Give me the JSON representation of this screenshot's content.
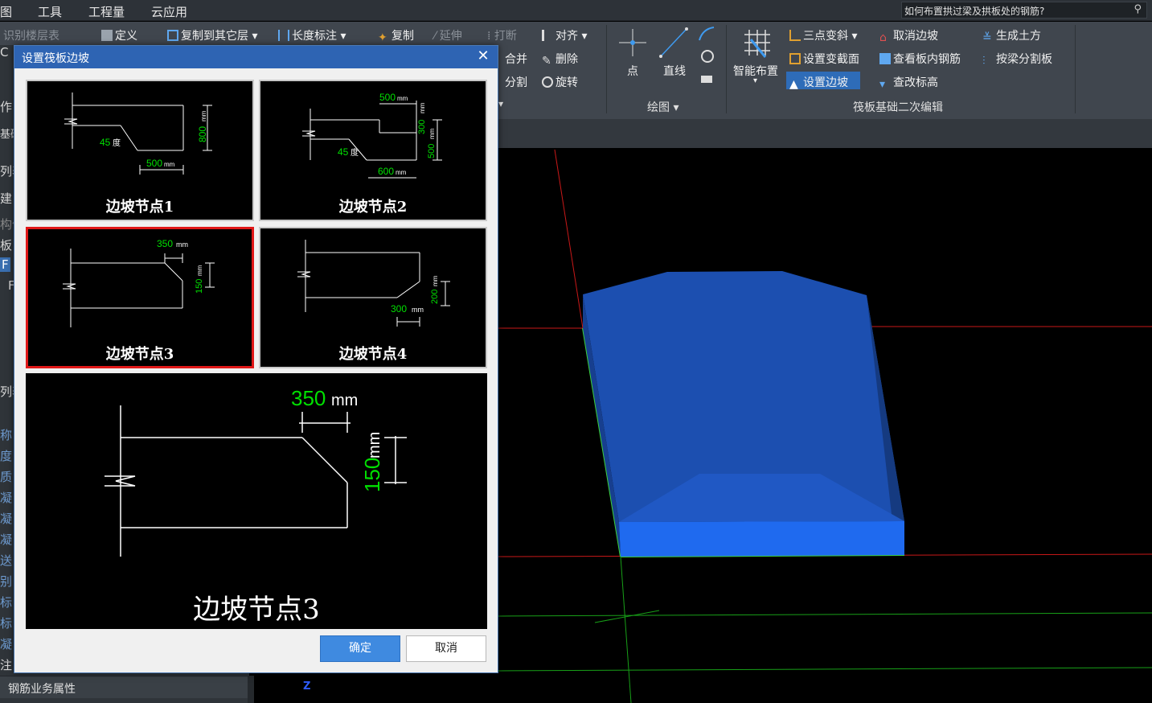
{
  "menubar": {
    "items": [
      "图",
      "工具",
      "工程量",
      "云应用"
    ],
    "help_search_value": "如何布置拱过梁及拱板处的钢筋?"
  },
  "ribbon": {
    "row1_left": [
      "识别楼层表",
      "定义",
      "复制到其它层",
      "长度标注",
      "复制",
      "延伸",
      "打断",
      "对齐"
    ],
    "row2_left": [
      "合并",
      "删除"
    ],
    "row3_left": [
      "分割",
      "旋转"
    ],
    "draw": {
      "point": "点",
      "line": "直线",
      "group_label": "绘图"
    },
    "smart_layout": "智能布置",
    "raft_edit": {
      "col1": [
        "三点变斜",
        "设置变截面",
        "设置边坡"
      ],
      "col2": [
        "取消边坡",
        "查看板内钢筋",
        "查改标高"
      ],
      "col3": [
        "生成土方",
        "按梁分割板"
      ],
      "group_label": "筏板基础二次编辑"
    }
  },
  "left_panel": {
    "fragments_top": [
      "作",
      "基础",
      "列表",
      "建",
      "构件",
      "板",
      "F",
      "F"
    ],
    "fragments_props": [
      "列表",
      "称",
      "度",
      "质",
      "凝",
      "凝",
      "凝",
      "送",
      "别",
      "标",
      "标",
      "凝",
      "注"
    ],
    "property_tab": "钢筋业务属性"
  },
  "dialog": {
    "title": "设置筏板边坡",
    "options": [
      {
        "caption": "边坡节点1",
        "dims": [
          "45",
          "度",
          "500",
          "mm",
          "800",
          "mm"
        ]
      },
      {
        "caption": "边坡节点2",
        "dims": [
          "500",
          "mm",
          "300",
          "mm",
          "45",
          "度",
          "500",
          "mm",
          "600",
          "mm"
        ]
      },
      {
        "caption": "边坡节点3",
        "dims": [
          "350",
          "mm",
          "150",
          "mm"
        ]
      },
      {
        "caption": "边坡节点4",
        "dims": [
          "200",
          "mm",
          "300",
          "mm"
        ]
      }
    ],
    "selected_index": 2,
    "preview": {
      "caption": "边坡节点3",
      "width_value": "350",
      "height_value": "150",
      "unit": "mm"
    },
    "ok_label": "确定",
    "cancel_label": "取消"
  },
  "viewport": {
    "axis_label": "Z"
  },
  "colors": {
    "titlebar": "#2e64b3",
    "selection": "#e01818",
    "dim_text": "#00e000",
    "slab": "#1c4fb0"
  }
}
